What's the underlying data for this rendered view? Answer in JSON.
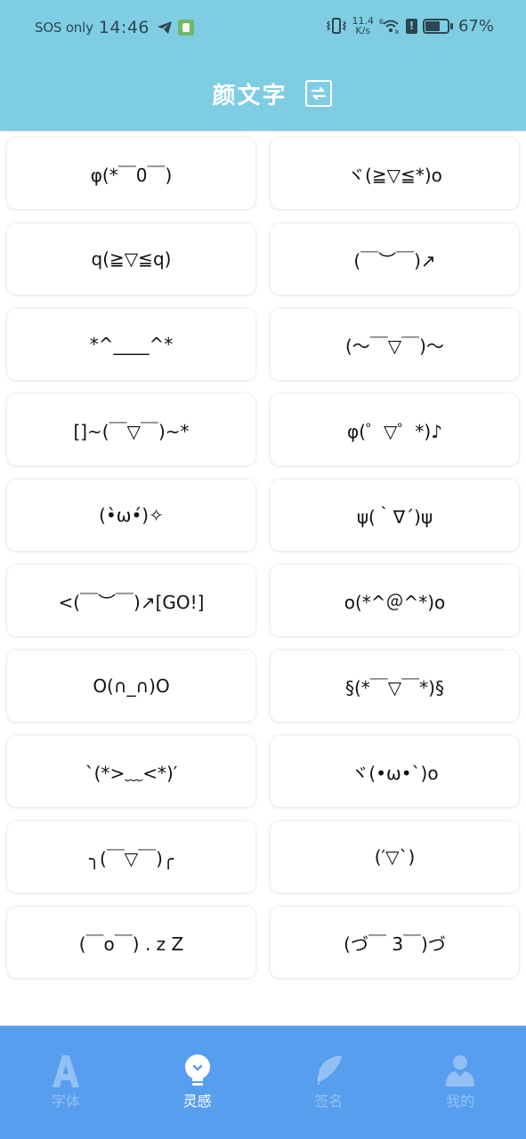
{
  "status_bar": {
    "carrier": "SOS only",
    "time": "14:46",
    "net_speed_value": "11.4",
    "net_speed_unit": "K/s",
    "wifi_badge": "6",
    "battery_percent": "67%",
    "battery_level": 0.67,
    "icons": [
      "telegram-icon",
      "app-notification-icon",
      "vibrate-icon",
      "wifi-icon",
      "alert-icon",
      "battery-icon"
    ]
  },
  "header": {
    "title": "颜文字",
    "action_icon": "swap-icon",
    "background_color": "#7fcde3"
  },
  "kaomoji": [
    "φ(*￣0￣)",
    "ヾ(≧▽≦*)o",
    "q(≧▽≦q)",
    "(￣︶￣)↗",
    "*^____^*",
    "(～￣▽￣)～",
    "[]~(￣▽￣)~*",
    "φ(゜▽゜*)♪",
    "(•̀ω•́)✧",
    "ψ(｀∇´)ψ",
    "<(￣︶￣)↗[GO!]",
    "o(*^＠^*)o",
    "O(∩_∩)O",
    "§(*￣▽￣*)§",
    "`(*>﹏<*)′",
    "ヾ(•ω•`)o",
    "╮(￣▽￣)╭",
    "(′▽`)",
    "(￣o￣) . z Z",
    "(づ￣ 3￣)づ"
  ],
  "bottom_nav": {
    "background_color": "#589eee",
    "items": [
      {
        "label": "字体",
        "icon": "font-a-icon",
        "active": false
      },
      {
        "label": "灵感",
        "icon": "lightbulb-icon",
        "active": true
      },
      {
        "label": "签名",
        "icon": "feather-icon",
        "active": false
      },
      {
        "label": "我的",
        "icon": "user-icon",
        "active": false
      }
    ]
  }
}
